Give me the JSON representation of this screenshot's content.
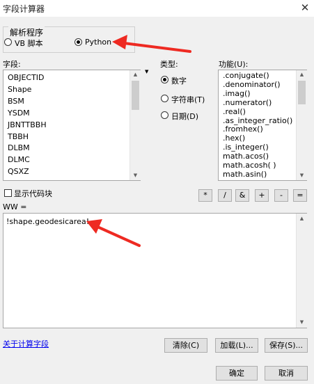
{
  "window": {
    "title": "字段计算器",
    "close_glyph": "✕"
  },
  "parser": {
    "legend": "解析程序",
    "options": [
      {
        "label": "VB 脚本",
        "selected": false
      },
      {
        "label": "Python",
        "selected": true
      }
    ]
  },
  "fields": {
    "label": "字段:",
    "items": [
      "OBJECTID",
      "Shape",
      "BSM",
      "YSDM",
      "JBNTTBBH",
      "TBBH",
      "DLBM",
      "DLMC",
      "QSXZ"
    ]
  },
  "type": {
    "label": "类型:",
    "options": [
      {
        "label": "数字",
        "selected": true
      },
      {
        "label": "字符串(T)",
        "selected": false
      },
      {
        "label": "日期(D)",
        "selected": false
      }
    ]
  },
  "functions": {
    "label": "功能(U):",
    "items": [
      ".conjugate()",
      ".denominator()",
      ".imag()",
      ".numerator()",
      ".real()",
      ".as_integer_ratio()",
      ".fromhex()",
      ".hex()",
      ".is_integer()",
      "math.acos()",
      "math.acosh( )",
      "math.asin()"
    ]
  },
  "show_codeblock": {
    "label": "显示代码块",
    "checked": false
  },
  "operators": [
    "*",
    "/",
    "&",
    "+",
    "-",
    "="
  ],
  "expression": {
    "label": "WW =",
    "value": "!shape.geodesicarea!"
  },
  "help_link": "关于计算字段",
  "buttons": {
    "clear": "清除(C)",
    "load": "加载(L)...",
    "save": "保存(S)...",
    "ok": "确定",
    "cancel": "取消"
  },
  "colors": {
    "annotation_arrow": "#ee2a22",
    "link": "#0000ee"
  }
}
